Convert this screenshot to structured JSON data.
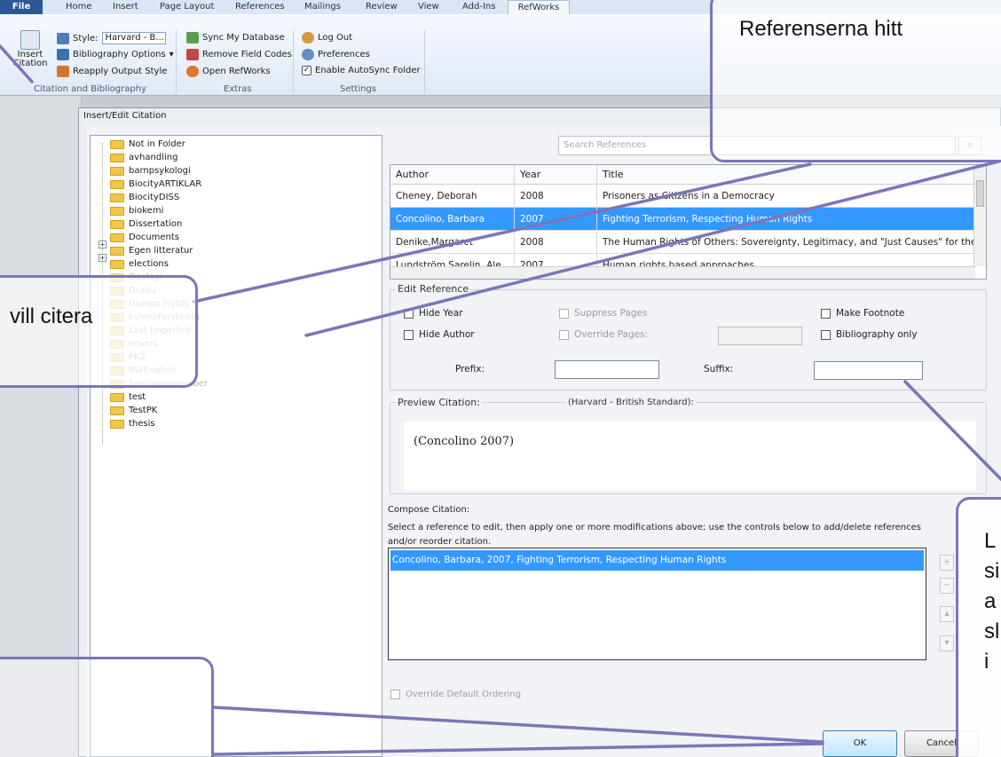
{
  "ribbon": {
    "tabs": [
      "File",
      "Home",
      "Insert",
      "Page Layout",
      "References",
      "Mailings",
      "Review",
      "View",
      "Add-Ins",
      "RefWorks"
    ],
    "insert_citation": "Insert Citation",
    "style_label": "Style:",
    "style_value": "Harvard - B...",
    "bibliography_options": "Bibliography Options",
    "reapply_output_style": "Reapply Output Style",
    "group_citation": "Citation and Bibliography",
    "sync_database": "Sync My Database",
    "remove_field_codes": "Remove Field Codes",
    "open_refworks": "Open RefWorks",
    "group_extras": "Extras",
    "log_out": "Log Out",
    "preferences": "Preferences",
    "enable_autosync": "Enable AutoSync Folder",
    "group_settings": "Settings"
  },
  "dialog": {
    "title": "Insert/Edit Citation",
    "folders": [
      {
        "name": "Not in Folder",
        "dim": false
      },
      {
        "name": "avhandling",
        "dim": false
      },
      {
        "name": "barnpsykologi",
        "dim": false
      },
      {
        "name": "BiocityARTIKLAR",
        "dim": false
      },
      {
        "name": "BiocityDISS",
        "dim": false
      },
      {
        "name": "biokemi",
        "dim": false
      },
      {
        "name": "Dissertation",
        "dim": false
      },
      {
        "name": "Documents",
        "dim": false
      },
      {
        "name": "Egen litteratur",
        "dim": false
      },
      {
        "name": "elections",
        "dim": false
      },
      {
        "name": "Geologi",
        "dim": true
      },
      {
        "name": "Gradu",
        "dim": true
      },
      {
        "name": "Human rights",
        "dim": true
      },
      {
        "name": "kvinnoforskning",
        "dim": true
      },
      {
        "name": "Last Imported",
        "dim": true
      },
      {
        "name": "novels",
        "dim": true
      },
      {
        "name": "PK2",
        "dim": true
      },
      {
        "name": "RWEnglish",
        "dim": true
      },
      {
        "name": "Sessionnovember",
        "dim": true
      },
      {
        "name": "test",
        "dim": false
      },
      {
        "name": "TestPK",
        "dim": false
      },
      {
        "name": "thesis",
        "dim": false
      }
    ],
    "search_placeholder": "Search References",
    "search_clear": "x",
    "grid_headers": [
      "Author",
      "Year",
      "Title"
    ],
    "grid_rows": [
      {
        "author": "Cheney, Deborah",
        "year": "2008",
        "title": "Prisoners as Citizens in a Democracy"
      },
      {
        "author": "Concolino, Barbara",
        "year": "2007",
        "title": "Fighting Terrorism, Respecting Human Rights"
      },
      {
        "author": "Denike,Margaret",
        "year": "2008",
        "title": "The Human Rights of Others: Sovereignty, Legitimacy, and \"Just Causes\" for the"
      },
      {
        "author": "Lundström Sarelin, Ale...",
        "year": "2007",
        "title": "Human rights based approaches..."
      }
    ],
    "edit_reference": "Edit Reference",
    "hide_year": "Hide Year",
    "hide_author": "Hide Author",
    "suppress_pages": "Suppress Pages",
    "override_pages": "Override Pages:",
    "make_footnote": "Make Footnote",
    "bibliography_only": "Bibliography only",
    "prefix": "Prefix:",
    "suffix": "Suffix:",
    "preview_label": "Preview Citation:",
    "preview_style": "(Harvard - British Standard):",
    "preview_text": "(Concolino 2007)",
    "compose_label": "Compose Citation:",
    "compose_help": "Select a reference to edit, then apply one or more modifications above; use the controls below to add/delete references and/or reorder citation.",
    "compose_item": "Concolino, Barbara, 2007, Fighting Terrorism, Respecting Human Rights",
    "override_ordering": "Override Default Ordering",
    "ok": "OK",
    "cancel": "Cancel"
  },
  "callouts": {
    "top": "Referenserna hitt",
    "left": "vill citera",
    "right_lines": [
      "L",
      "si",
      "a",
      "sl",
      "i"
    ]
  }
}
